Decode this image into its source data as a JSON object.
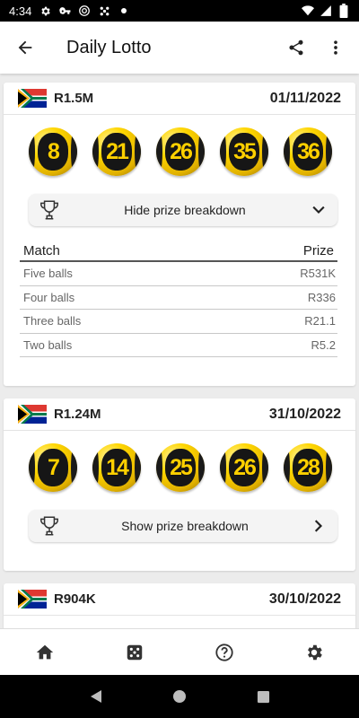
{
  "status_bar": {
    "time": "4:34",
    "icons": [
      "gear-icon",
      "vpn-key-icon",
      "hotspot-icon",
      "dots-icon",
      "dot-icon"
    ],
    "right_icons": [
      "wifi-icon",
      "signal-icon",
      "battery-icon"
    ]
  },
  "app_bar": {
    "title": "Daily Lotto",
    "back_icon": "arrow-back-icon",
    "actions": [
      "share-icon",
      "more-vert-icon"
    ]
  },
  "draws": [
    {
      "jackpot": "R1.5M",
      "date": "01/11/2022",
      "balls": [
        "8",
        "21",
        "26",
        "35",
        "36"
      ],
      "toggle_label": "Hide prize breakdown",
      "expanded": true,
      "prize_header": {
        "match": "Match",
        "prize": "Prize"
      },
      "prizes": [
        {
          "match": "Five balls",
          "prize": "R531K"
        },
        {
          "match": "Four balls",
          "prize": "R336"
        },
        {
          "match": "Three balls",
          "prize": "R21.1"
        },
        {
          "match": "Two balls",
          "prize": "R5.2"
        }
      ]
    },
    {
      "jackpot": "R1.24M",
      "date": "31/10/2022",
      "balls": [
        "7",
        "14",
        "25",
        "26",
        "28"
      ],
      "toggle_label": "Show prize breakdown",
      "expanded": false
    },
    {
      "jackpot": "R904K",
      "date": "30/10/2022"
    }
  ],
  "bottom_nav": [
    "home-icon",
    "dice-icon",
    "help-icon",
    "settings-icon"
  ],
  "colors": {
    "ball_yellow": "#ffd600",
    "ball_number": "#ffd000",
    "ball_dark": "#161616",
    "flag_green": "#007a4d",
    "flag_red": "#de3831",
    "flag_blue": "#002395",
    "flag_gold": "#ffb612"
  }
}
